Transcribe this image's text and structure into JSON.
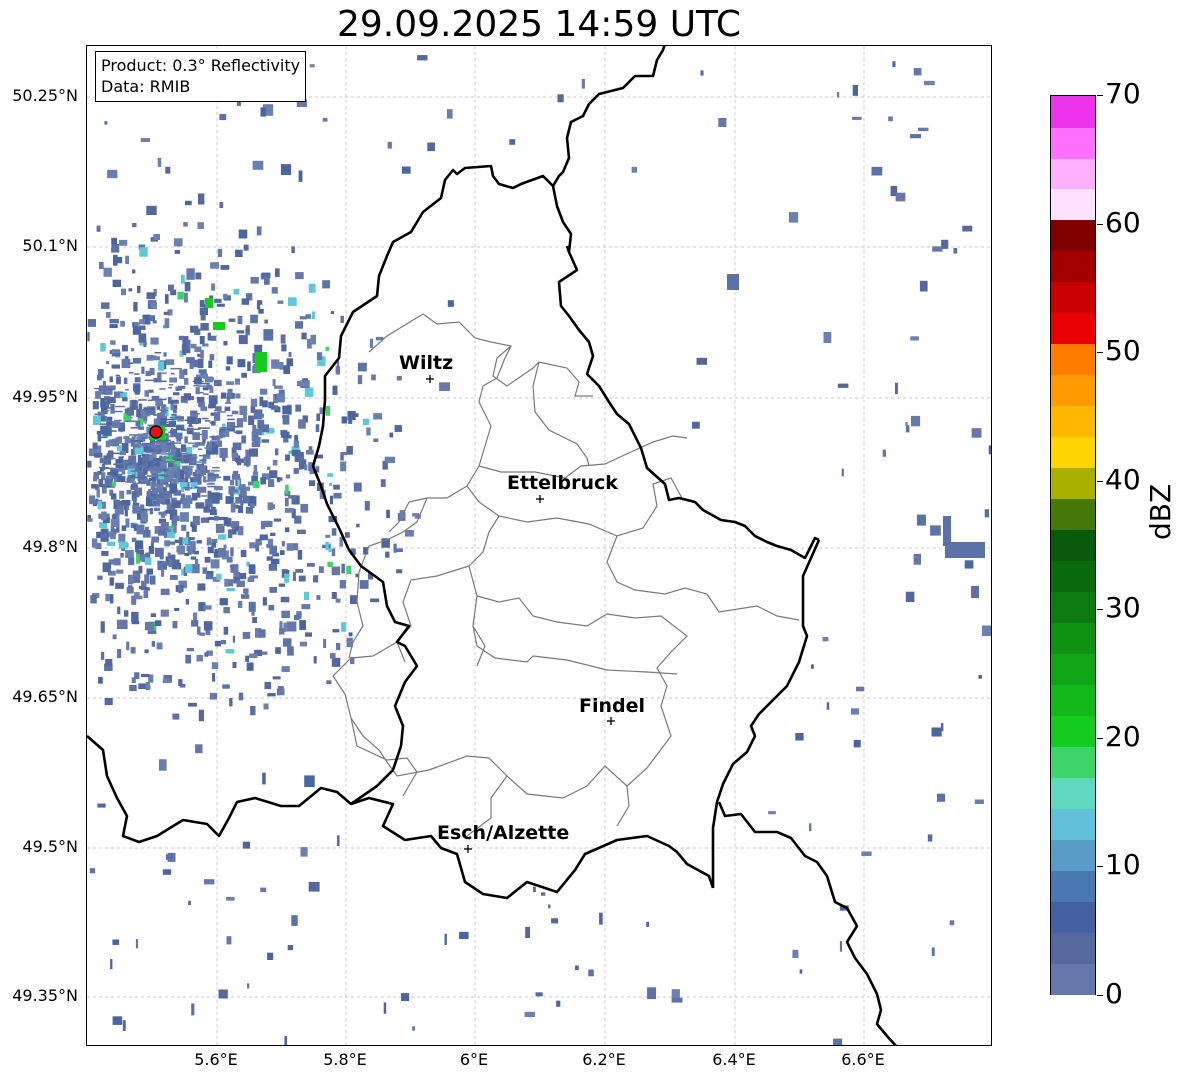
{
  "title": "29.09.2025 14:59 UTC",
  "info": {
    "product": "Product: 0.3° Reflectivity",
    "data": "Data: RMIB"
  },
  "lat_ticks": [
    "50.25°N",
    "50.1°N",
    "49.95°N",
    "49.8°N",
    "49.65°N",
    "49.5°N",
    "49.35°N"
  ],
  "lon_ticks": [
    "5.6°E",
    "5.8°E",
    "6°E",
    "6.2°E",
    "6.4°E",
    "6.6°E"
  ],
  "colorbar": {
    "unit": "dBZ",
    "tick_labels": [
      "0",
      "10",
      "20",
      "30",
      "40",
      "50",
      "60",
      "70"
    ],
    "colors": [
      "#6677aa",
      "#55689e",
      "#4560a0",
      "#4a78b0",
      "#5a9cc8",
      "#62c0d8",
      "#5fd8c0",
      "#3dd46a",
      "#14cc1e",
      "#12b81a",
      "#10a514",
      "#0e9212",
      "#0c7c10",
      "#0a6a0e",
      "#0a5a0c",
      "#447a08",
      "#aab000",
      "#ffd500",
      "#ffb800",
      "#ff9a00",
      "#ff7c00",
      "#e60000",
      "#c80000",
      "#a40000",
      "#800000",
      "#ffe0ff",
      "#ffb0ff",
      "#ff70ff",
      "#ee33ee"
    ]
  },
  "cities": [
    {
      "name": "Wiltz"
    },
    {
      "name": "Ettelbruck"
    },
    {
      "name": "Findel"
    },
    {
      "name": "Esch/Alzette"
    }
  ],
  "radar_site": {
    "color": "#e81010"
  }
}
